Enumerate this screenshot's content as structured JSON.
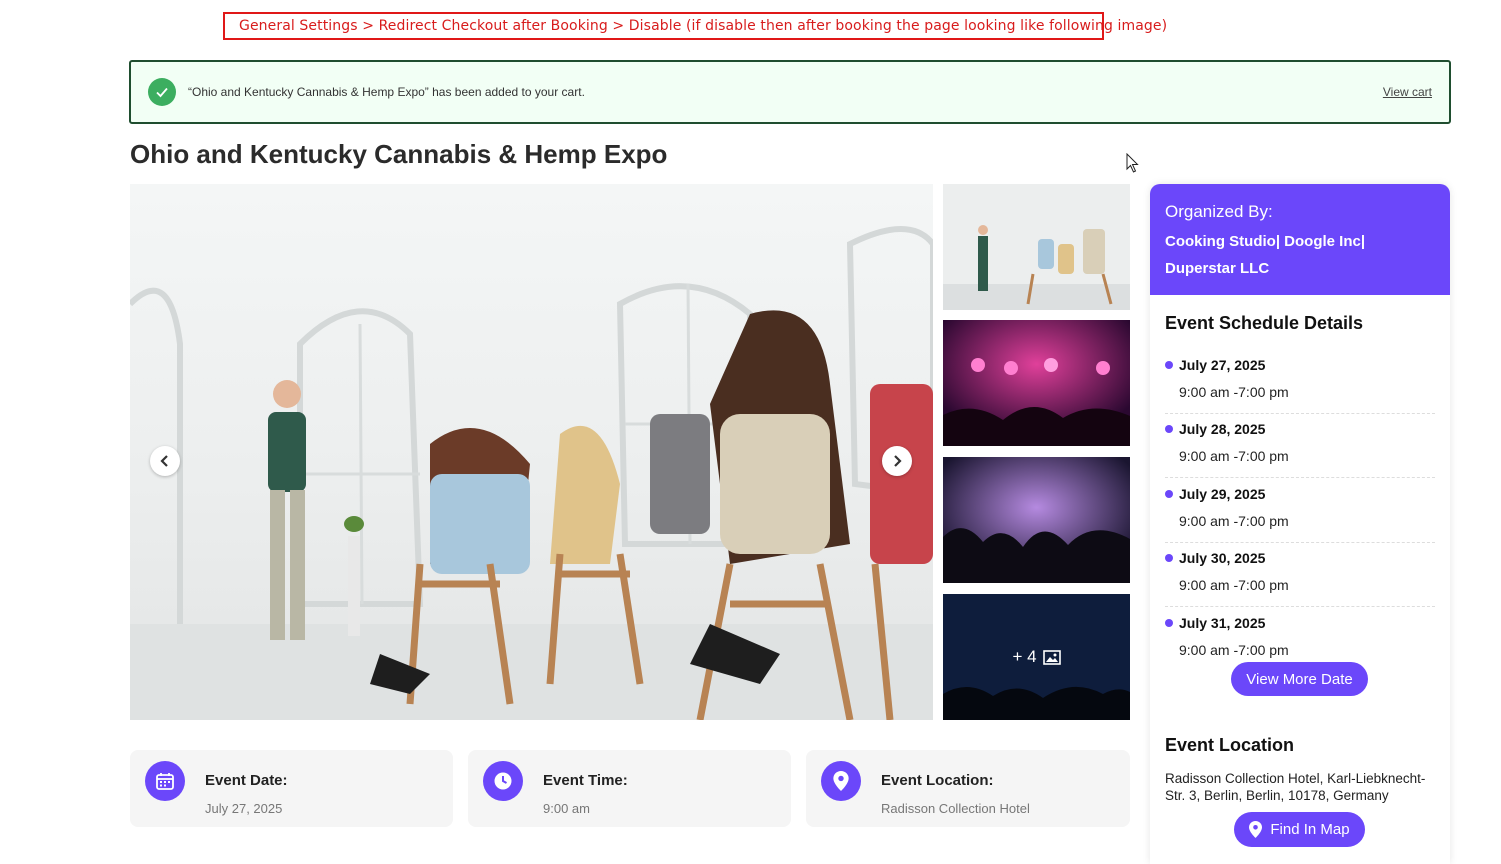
{
  "annotation": "General Settings > Redirect Checkout after Booking > Disable (if disable then after booking the page looking like following image)",
  "notice": {
    "message": "“Ohio and Kentucky Cannabis & Hemp Expo” has been added to your cart.",
    "view_cart": "View cart",
    "color": "#3cae60"
  },
  "event": {
    "title": "Ohio and Kentucky Cannabis & Hemp Expo",
    "more_images": "+ 4"
  },
  "sidebar": {
    "organized_label": "Organized By:",
    "organizers": "Cooking Studio| Doogle Inc| Duperstar LLC",
    "schedule_title": "Event Schedule Details",
    "schedule": [
      {
        "date": "July 27, 2025",
        "time": "9:00 am -7:00 pm"
      },
      {
        "date": "July 28, 2025",
        "time": "9:00 am -7:00 pm"
      },
      {
        "date": "July 29, 2025",
        "time": "9:00 am -7:00 pm"
      },
      {
        "date": "July 30, 2025",
        "time": "9:00 am -7:00 pm"
      },
      {
        "date": "July 31, 2025",
        "time": "9:00 am -7:00 pm"
      }
    ],
    "view_more": "View More Date",
    "location_title": "Event Location",
    "location_address": "Radisson Collection Hotel, Karl-Liebknecht-Str. 3, Berlin, Berlin, 10178, Germany",
    "find_map": "Find In Map"
  },
  "info_cards": [
    {
      "label": "Event Date:",
      "value": "July 27, 2025",
      "icon": "calendar-icon"
    },
    {
      "label": "Event Time:",
      "value": "9:00 am",
      "icon": "clock-icon"
    },
    {
      "label": "Event Location:",
      "value": "Radisson Collection Hotel",
      "icon": "map-pin-icon"
    }
  ],
  "colors": {
    "accent": "#6b47fa",
    "annotation": "#e01818"
  }
}
